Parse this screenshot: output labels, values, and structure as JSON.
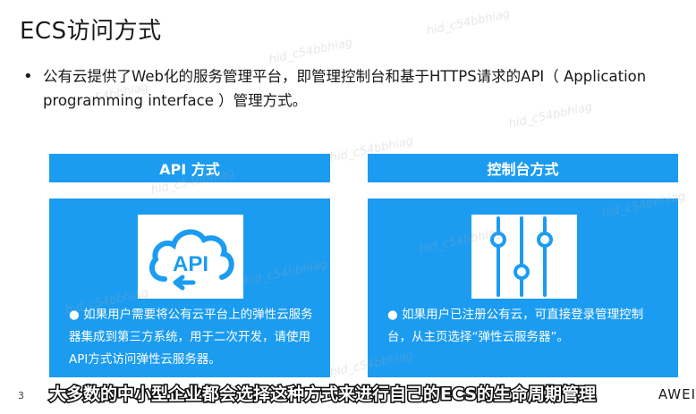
{
  "slide": {
    "title": "ECS访问方式",
    "bullet": "公有云提供了Web化的服务管理平台，即管理控制台和基于HTTPS请求的API（ Application programming interface ）管理方式。",
    "page_number": "3",
    "brand": "AWEI"
  },
  "columns": [
    {
      "header": "API 方式",
      "icon_text": "API",
      "description": "● 如果用户需要将公有云平台上的弹性云服务器集成到第三方系统，用于二次开发，请使用API方式访问弹性云服务器。"
    },
    {
      "header": "控制台方式",
      "description": "● 如果用户已注册公有云，可直接登录管理控制台，从主页选择“弹性云服务器”。"
    }
  ],
  "subtitle": "大多数的中小型企业都会选择这种方式来进行自己的ECS的生命周期管理",
  "watermark": "hid_c54bbhiag",
  "colors": {
    "accent": "#1b9cf1",
    "text": "#1a1a1a",
    "white": "#ffffff"
  }
}
